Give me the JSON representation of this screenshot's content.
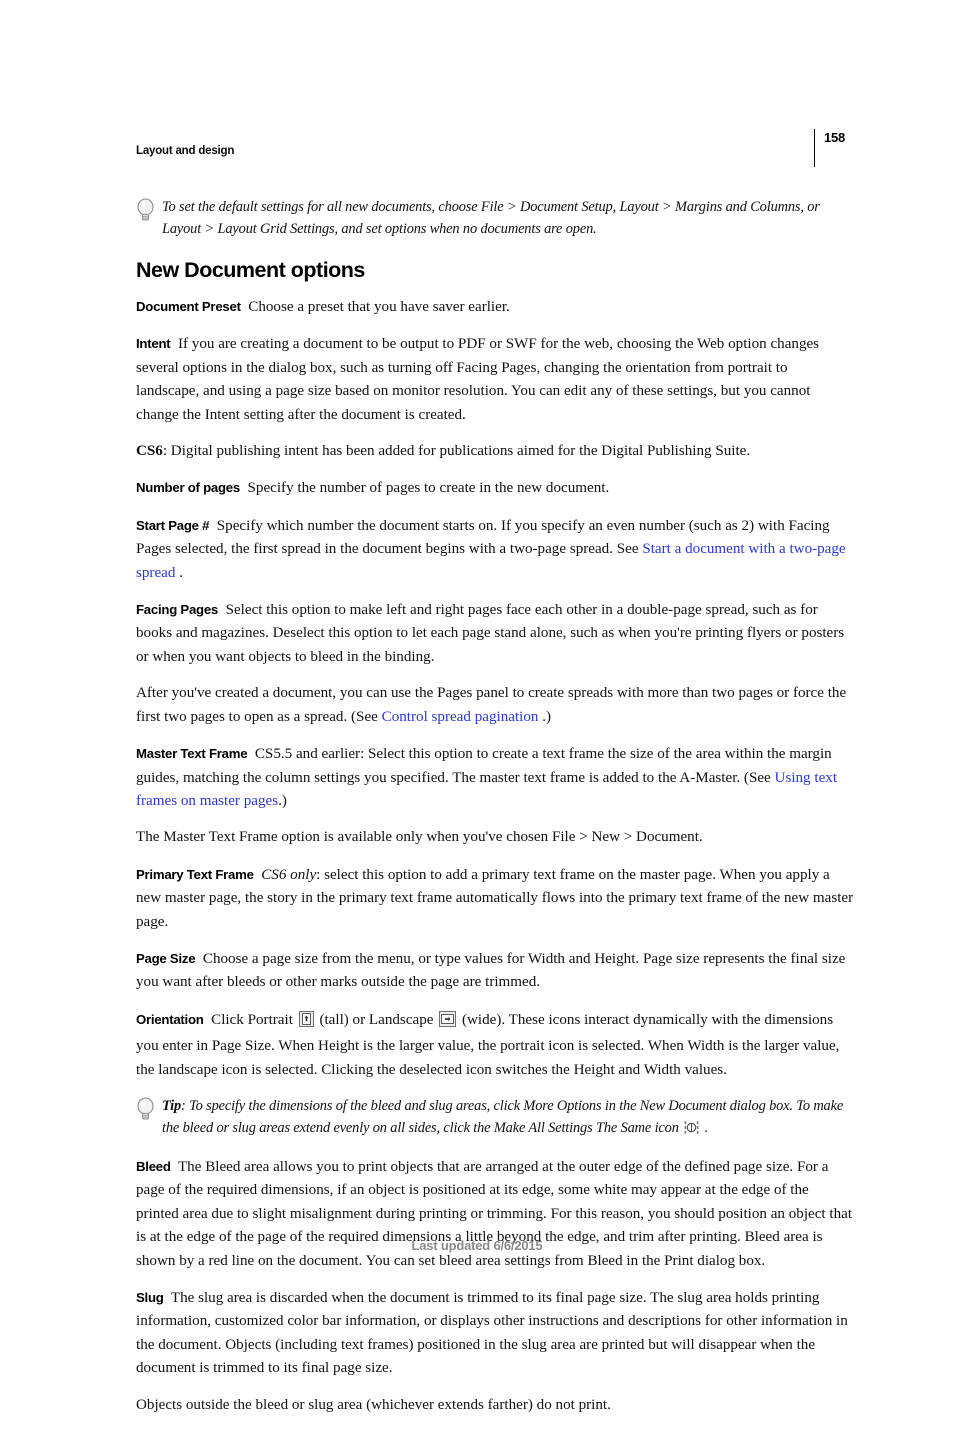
{
  "header": {
    "title": "Layout and design",
    "page_number": "158"
  },
  "tip_top": {
    "icon": "lightbulb-icon",
    "text": "To set the default settings for all new documents, choose File > Document Setup, Layout > Margins and Columns, or Layout > Layout Grid Settings, and set options when no documents are open."
  },
  "section": {
    "title": "New Document options"
  },
  "paragraphs": {
    "document_preset": {
      "label": "Document Preset",
      "text": "Choose a preset that you have saver earlier."
    },
    "intent": {
      "label": "Intent",
      "text": "If you are creating a document to be output to PDF or SWF for the web, choosing the Web option changes several options in the dialog box, such as turning off Facing Pages, changing the orientation from portrait to landscape, and using a page size based on monitor resolution. You can edit any of these settings, but you cannot change the Intent setting after the document is created."
    },
    "cs6": {
      "label": "CS6",
      "text": ": Digital publishing intent has been added for publications aimed for the Digital Publishing Suite."
    },
    "number_of_pages": {
      "label": "Number of pages",
      "text": "Specify the number of pages to create in the new document."
    },
    "start_page": {
      "label": "Start Page #",
      "text_before_link": "Specify which number the document starts on. If you specify an even number (such as 2) with Facing Pages selected, the first spread in the document begins with a two-page spread. See",
      "link": "Start a document with a two-page spread",
      "text_after_link": "."
    },
    "facing_pages": {
      "label": "Facing Pages",
      "text": "Select this option to make left and right pages face each other in a double-page spread, such as for books and magazines. Deselect this option to let each page stand alone, such as when you're printing flyers or posters or when you want objects to bleed in the binding."
    },
    "after_created": {
      "text_before_link": "After you've created a document, you can use the Pages panel to create spreads with more than two pages or force the first two pages to open as a spread. (See",
      "link": "Control spread pagination",
      "text_after_link": ".)"
    },
    "master_text_frame": {
      "label": "Master Text Frame",
      "text_before_link": "CS5.5 and earlier: Select this option to create a text frame the size of the area within the margin guides, matching the column settings you specified. The master text frame is added to the A-Master. (See",
      "link": "Using text frames on master pages",
      "text_after_link": ".)"
    },
    "master_text_frame_note": {
      "text": "The Master Text Frame option is available only when you've chosen File > New > Document."
    },
    "primary_text_frame": {
      "label": "Primary Text Frame",
      "italic_lead": "CS6 only",
      "text": ": select this option to add a primary text frame on the master page. When you apply a new master page, the story in the primary text frame automatically flows into the primary text frame of the new master page."
    },
    "page_size": {
      "label": "Page Size",
      "text": "Choose a page size from the menu, or type values for Width and Height. Page size represents the final size you want after bleeds or other marks outside the page are trimmed."
    },
    "orientation": {
      "label": "Orientation",
      "text_1": "Click Portrait",
      "portrait_icon": "portrait-orientation-icon",
      "text_2": "(tall) or Landscape",
      "landscape_icon": "landscape-orientation-icon",
      "text_3": "(wide). These icons interact dynamically with the dimensions you enter in Page Size. When Height is the larger value, the portrait icon is selected. When Width is the larger value, the landscape icon is selected. Clicking the deselected icon switches the Height and Width values."
    },
    "bleed": {
      "label": "Bleed",
      "text": "The Bleed area allows you to print objects that are arranged at the outer edge of the defined page size. For a page of the required dimensions, if an object is positioned at its edge, some white may appear at the edge of the printed area due to slight misalignment during printing or trimming. For this reason, you should position an object that is at the edge of the page of the required dimensions a little beyond the edge, and trim after printing. Bleed area is shown by a red line on the document. You can set bleed area settings from Bleed in the Print dialog box."
    },
    "slug": {
      "label": "Slug",
      "text": "The slug area is discarded when the document is trimmed to its final page size. The slug area holds printing information, customized color bar information, or displays other instructions and descriptions for other information in the document. Objects (including text frames) positioned in the slug area are printed but will disappear when the document is trimmed to its final page size."
    },
    "objects_outside": {
      "text": "Objects outside the bleed or slug area (whichever extends farther) do not print."
    }
  },
  "tip_bleed": {
    "icon": "lightbulb-icon",
    "label": "Tip",
    "text_1": ": To specify the dimensions of the bleed and slug areas, click More Options in the New Document dialog box. To make the bleed or slug areas extend evenly on all sides, click the Make All Settings The Same icon",
    "same_settings_icon": "make-all-settings-the-same-icon",
    "text_2": "."
  },
  "footer": {
    "text": "Last updated 6/6/2015"
  },
  "colors": {
    "link": "#2b37d8",
    "text": "#111111",
    "footer": "#8a8a8a"
  }
}
